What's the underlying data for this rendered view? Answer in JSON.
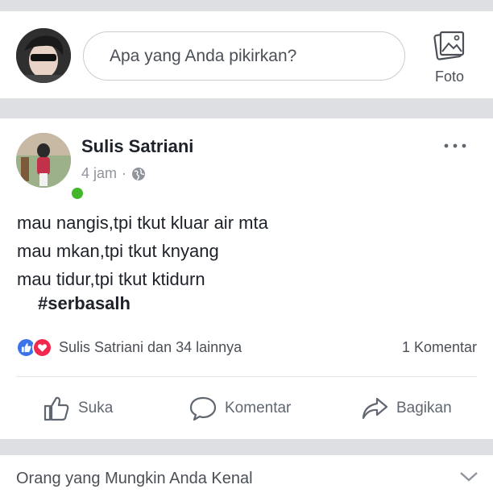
{
  "composer": {
    "placeholder": "Apa yang Anda pikirkan?",
    "photo_label": "Foto",
    "photo_icon": "photo-icon"
  },
  "post": {
    "author": "Sulis Satriani",
    "time": "4 jam",
    "separator": "·",
    "privacy_icon": "globe-icon",
    "online": true,
    "body_lines": [
      "mau nangis,tpi tkut kluar air mta",
      "mau mkan,tpi tkut knyang",
      "mau tidur,tpi tkut ktidurn"
    ],
    "hashtag": "#serbasalh",
    "reactions_text": "Sulis Satriani dan 34 lainnya",
    "comments_text": "1 Komentar",
    "actions": {
      "like": "Suka",
      "comment": "Komentar",
      "share": "Bagikan"
    }
  },
  "suggestions": {
    "title": "Orang yang Mungkin Anda Kenal"
  },
  "colors": {
    "background": "#dddfe2",
    "like_blue": "#3b73e8",
    "love_red": "#f0294f",
    "online_green": "#42b72a",
    "muted_text": "#90949c"
  }
}
